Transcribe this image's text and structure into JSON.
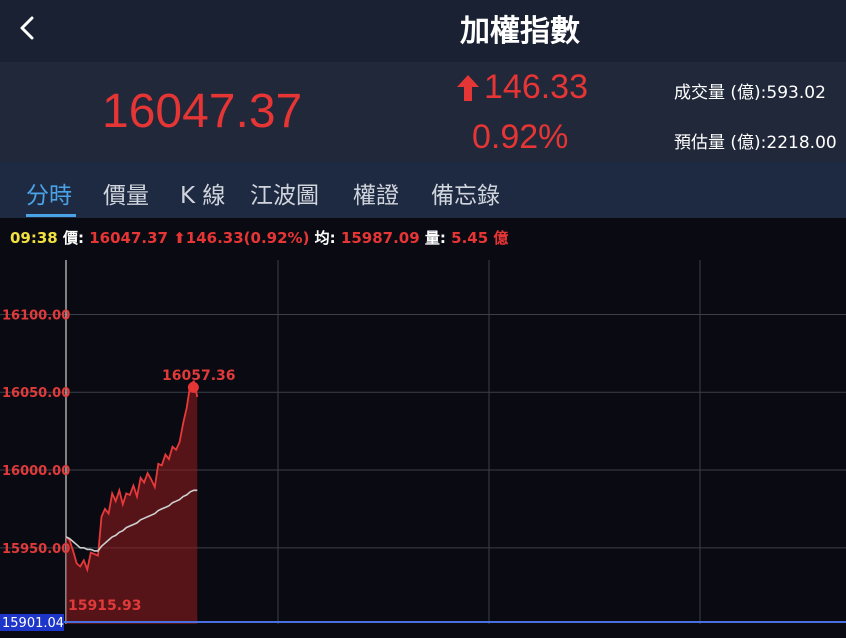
{
  "header": {
    "title": "加權指數"
  },
  "quote": {
    "price": "16047.37",
    "change": "146.33",
    "change_pct": "0.92%",
    "volume_label": "成交量 (億):",
    "volume_value": "593.02",
    "est_volume_label": "預估量 (億):",
    "est_volume_value": "2218.00",
    "up_color": "#e63535"
  },
  "tabs": [
    {
      "label": "分時",
      "active": true
    },
    {
      "label": "價量",
      "active": false
    },
    {
      "label": "K 線",
      "active": false
    },
    {
      "label": "江波圖",
      "active": false
    },
    {
      "label": "權證",
      "active": false
    },
    {
      "label": "備忘錄",
      "active": false
    }
  ],
  "info": {
    "time": "09:38",
    "price_label": "價:",
    "price": "16047.37",
    "change": "146.33(0.92%)",
    "avg_label": "均:",
    "avg": "15987.09",
    "vol_label": "量:",
    "vol": "5.45 億"
  },
  "chart_data": {
    "type": "line",
    "y_ticks": [
      "16100.00",
      "16050.00",
      "16000.00",
      "15950.00"
    ],
    "y_tick_values": [
      16100,
      16050,
      16000,
      15950
    ],
    "ylim": [
      15901.04,
      16135
    ],
    "baseline_label": "15901.04",
    "baseline_value": 15901.04,
    "high_label": "16057.36",
    "low_label": "15915.93",
    "grid": true,
    "series": [
      {
        "values": [
          15957,
          15955,
          15948,
          15940,
          15938,
          15942,
          15936,
          15947,
          15946,
          15945,
          15970,
          15975,
          15972,
          15985,
          15980,
          15987,
          15978,
          15985,
          15984,
          15990,
          15983,
          15995,
          15992,
          15998,
          15994,
          15989,
          16004,
          16003,
          16010,
          16007,
          16015,
          16013,
          16018,
          16030,
          16040,
          16055,
          16057,
          16047
        ]
      },
      {
        "values": [
          15957,
          15956,
          15954,
          15952,
          15950,
          15950,
          15949,
          15949,
          15948,
          15948,
          15951,
          15953,
          15955,
          15957,
          15958,
          15960,
          15961,
          15963,
          15964,
          15965,
          15966,
          15968,
          15969,
          15970,
          15971,
          15972,
          15974,
          15975,
          15976,
          15977,
          15979,
          15980,
          15981,
          15983,
          15984,
          15986,
          15987,
          15987
        ]
      }
    ]
  }
}
